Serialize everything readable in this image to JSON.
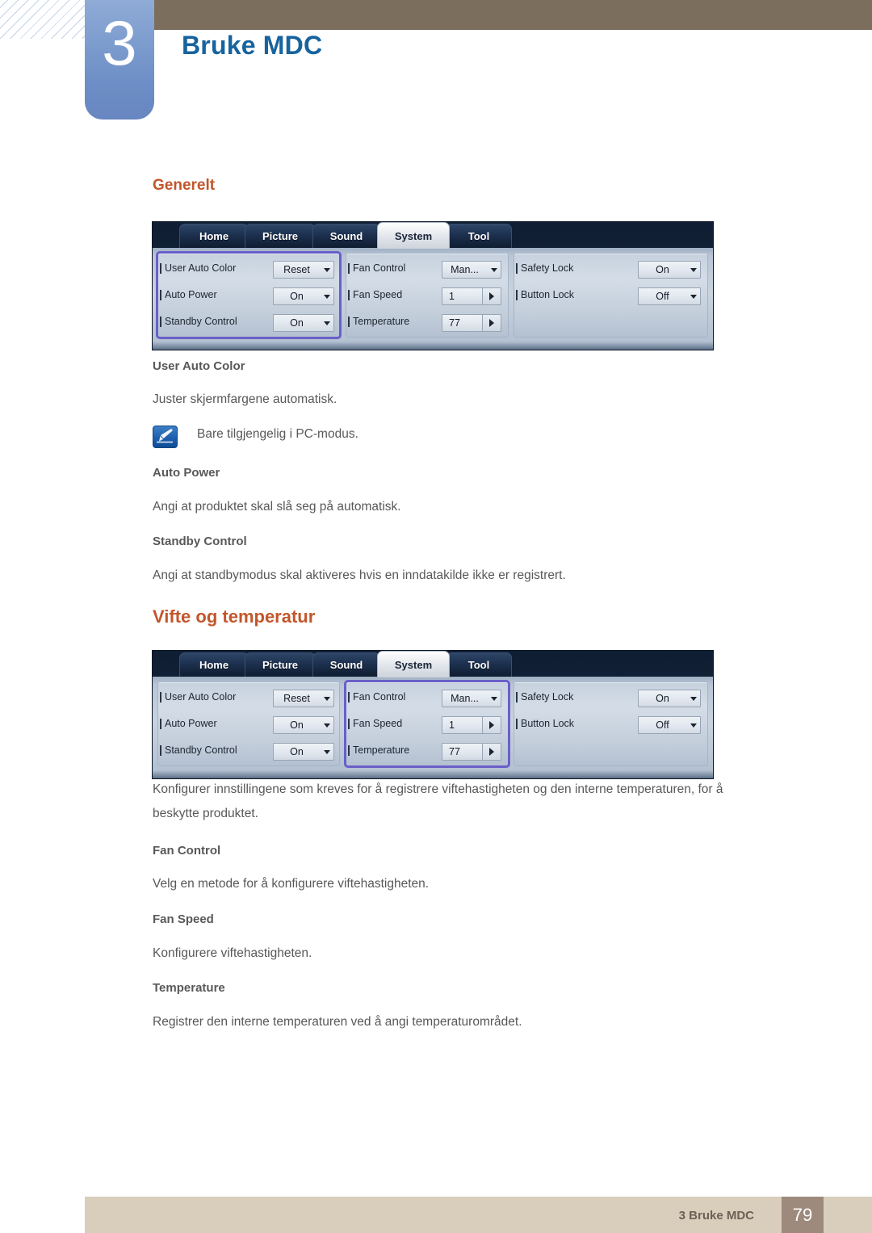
{
  "header": {
    "chapter_number": "3",
    "title": "Bruke MDC",
    "brand_blue": "#17639e",
    "bar_brown": "#7c6e5d"
  },
  "sections": {
    "generelt": {
      "heading": "Generelt",
      "terms": [
        {
          "term": "User Auto Color",
          "desc": "Juster skjermfargene automatisk."
        },
        {
          "term": "Auto Power",
          "desc": "Angi at produktet skal slå seg på automatisk."
        },
        {
          "term": "Standby Control",
          "desc": "Angi at standbymodus skal aktiveres hvis en inndatakilde ikke er registrert."
        }
      ],
      "note": "Bare tilgjengelig i PC-modus."
    },
    "vifte": {
      "heading": "Vifte og temperatur",
      "intro_line1": "Konfigurer innstillingene som kreves for å registrere viftehastigheten og den interne temperaturen, for å",
      "intro_line2": "beskytte produktet.",
      "terms": [
        {
          "term": "Fan Control",
          "desc": "Velg en metode for å konfigurere viftehastigheten."
        },
        {
          "term": "Fan Speed",
          "desc": "Konfigurere viftehastigheten."
        },
        {
          "term": "Temperature",
          "desc": "Registrer den interne temperaturen ved å angi temperaturområdet."
        }
      ]
    }
  },
  "mdc_panel": {
    "tabs": [
      {
        "label": "Home",
        "active": false
      },
      {
        "label": "Picture",
        "active": false
      },
      {
        "label": "Sound",
        "active": false
      },
      {
        "label": "System",
        "active": true
      },
      {
        "label": "Tool",
        "active": false
      }
    ],
    "groups": [
      {
        "name": "general-group",
        "rows": [
          {
            "label": "User Auto Color",
            "value": "Reset",
            "control": "dropdown"
          },
          {
            "label": "Auto Power",
            "value": "On",
            "control": "dropdown"
          },
          {
            "label": "Standby Control",
            "value": "On",
            "control": "dropdown"
          }
        ]
      },
      {
        "name": "fan-temperature-group",
        "rows": [
          {
            "label": "Fan Control",
            "value": "Man...",
            "control": "dropdown"
          },
          {
            "label": "Fan Speed",
            "value": "1",
            "control": "spinner"
          },
          {
            "label": "Temperature",
            "value": "77",
            "control": "spinner"
          }
        ]
      },
      {
        "name": "lock-group",
        "rows": [
          {
            "label": "Safety Lock",
            "value": "On",
            "control": "dropdown"
          },
          {
            "label": "Button Lock",
            "value": "Off",
            "control": "dropdown"
          }
        ]
      }
    ],
    "highlight_color": "#6a5fc9",
    "screenshot_1_highlighted_group": 0,
    "screenshot_2_highlighted_group": 1
  },
  "footer": {
    "text": "3 Bruke MDC",
    "page": "79"
  }
}
